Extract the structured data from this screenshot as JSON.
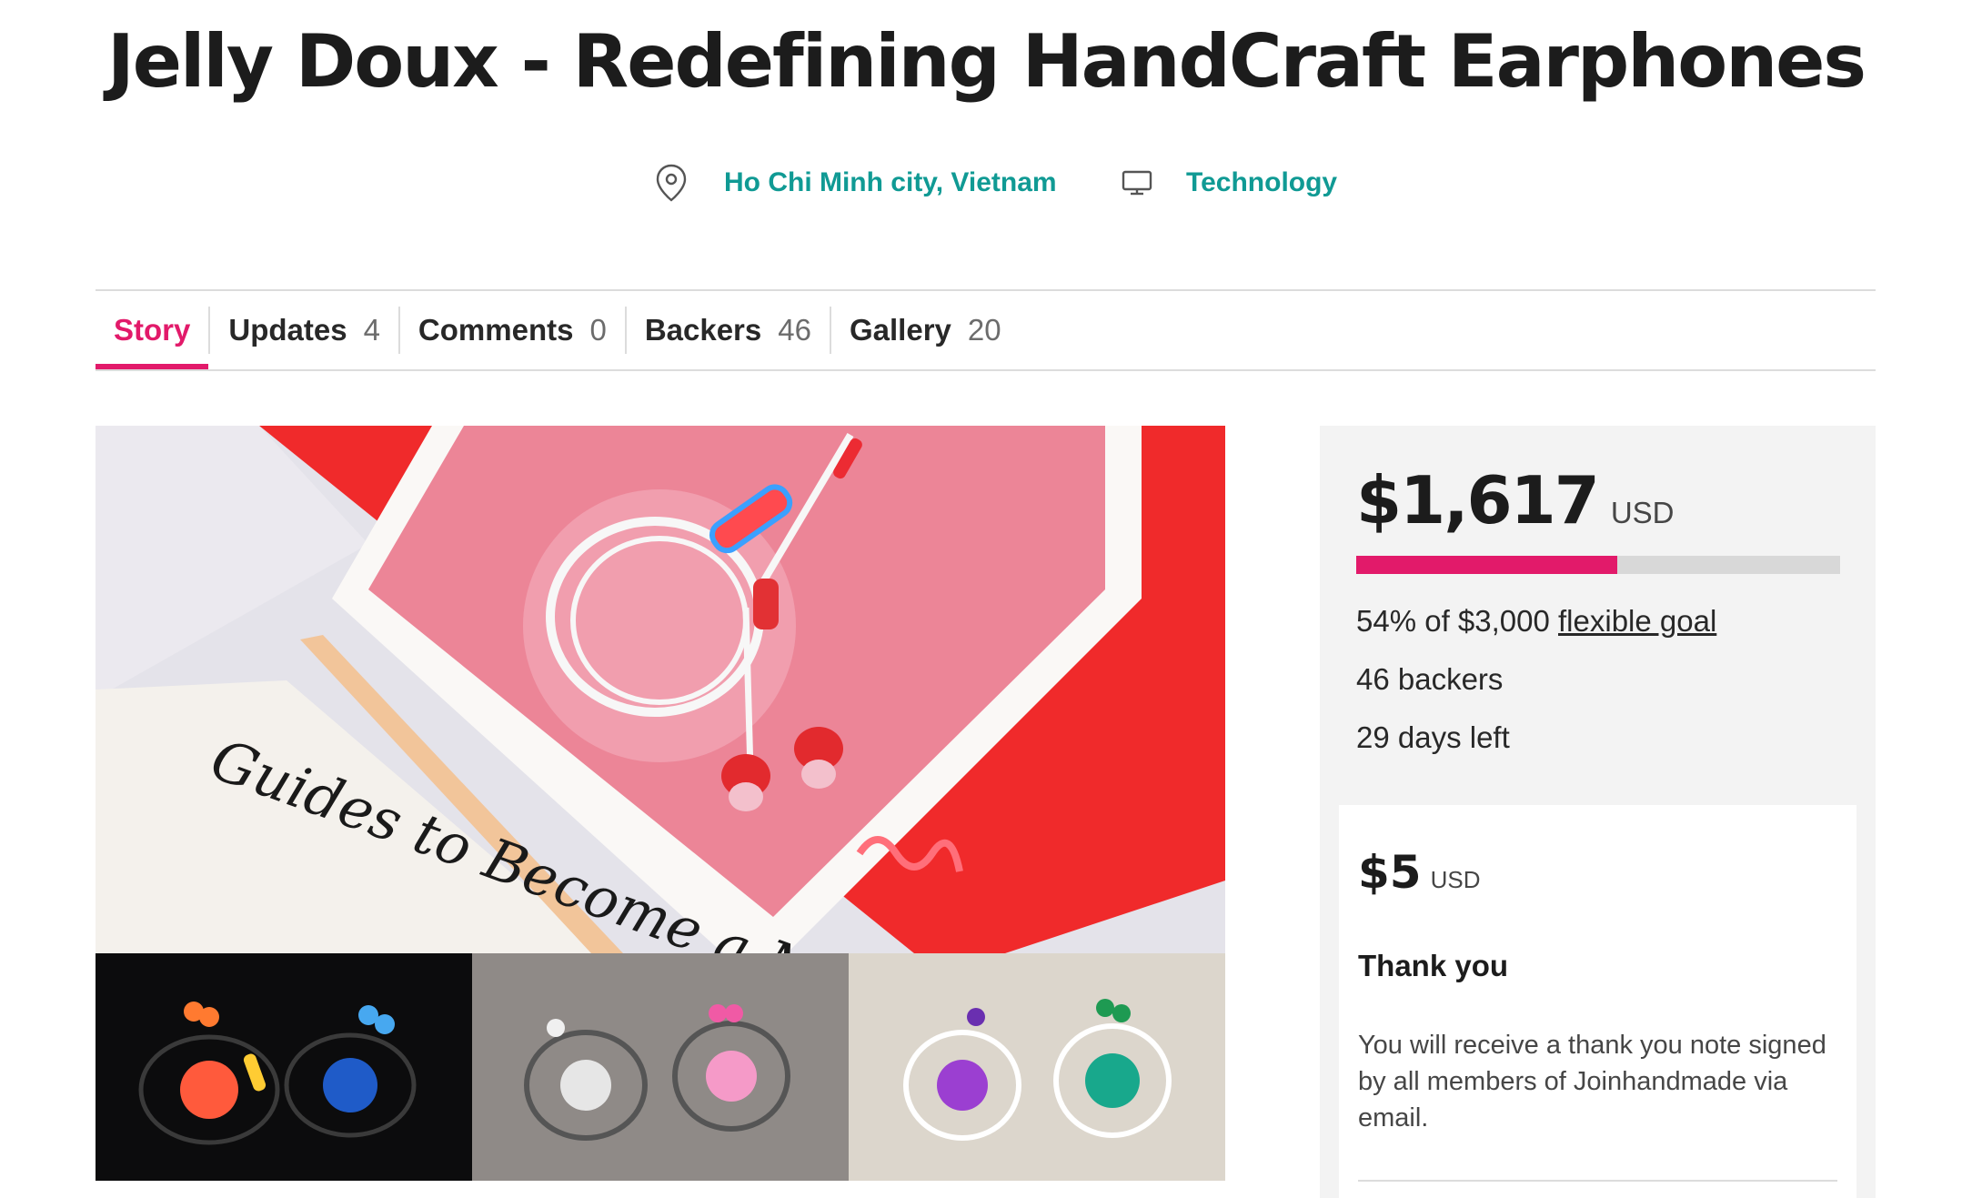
{
  "project": {
    "title": "Jelly Doux - Redefining HandCraft Earphones",
    "location": "Ho Chi Minh city, Vietnam",
    "category": "Technology",
    "hero_text": "Guides to Become a Modern Lady"
  },
  "tabs": [
    {
      "label": "Story",
      "count": ""
    },
    {
      "label": "Updates",
      "count": "4"
    },
    {
      "label": "Comments",
      "count": "0"
    },
    {
      "label": "Backers",
      "count": "46"
    },
    {
      "label": "Gallery",
      "count": "20"
    }
  ],
  "funding": {
    "amount": "$1,617",
    "currency": "USD",
    "percent": 54,
    "goal_prefix": "54% of $3,000",
    "goal_link": "flexible goal",
    "backers": "46 backers",
    "days_left": "29 days left"
  },
  "reward": {
    "amount": "$5",
    "currency": "USD",
    "title": "Thank you",
    "description": "You will receive a thank you note signed by all members of Joinhandmade via email."
  },
  "colors": {
    "accent": "#e21a6a",
    "link": "#109a94",
    "hero_red": "#f02a2b",
    "earbud_colors": [
      "#ff5a3c",
      "#1f5bc8",
      "#e6e6e6",
      "#f59ac8",
      "#9b3fd1",
      "#18a88c"
    ]
  },
  "icons": {
    "location": "map-pin-icon",
    "category": "monitor-icon"
  }
}
